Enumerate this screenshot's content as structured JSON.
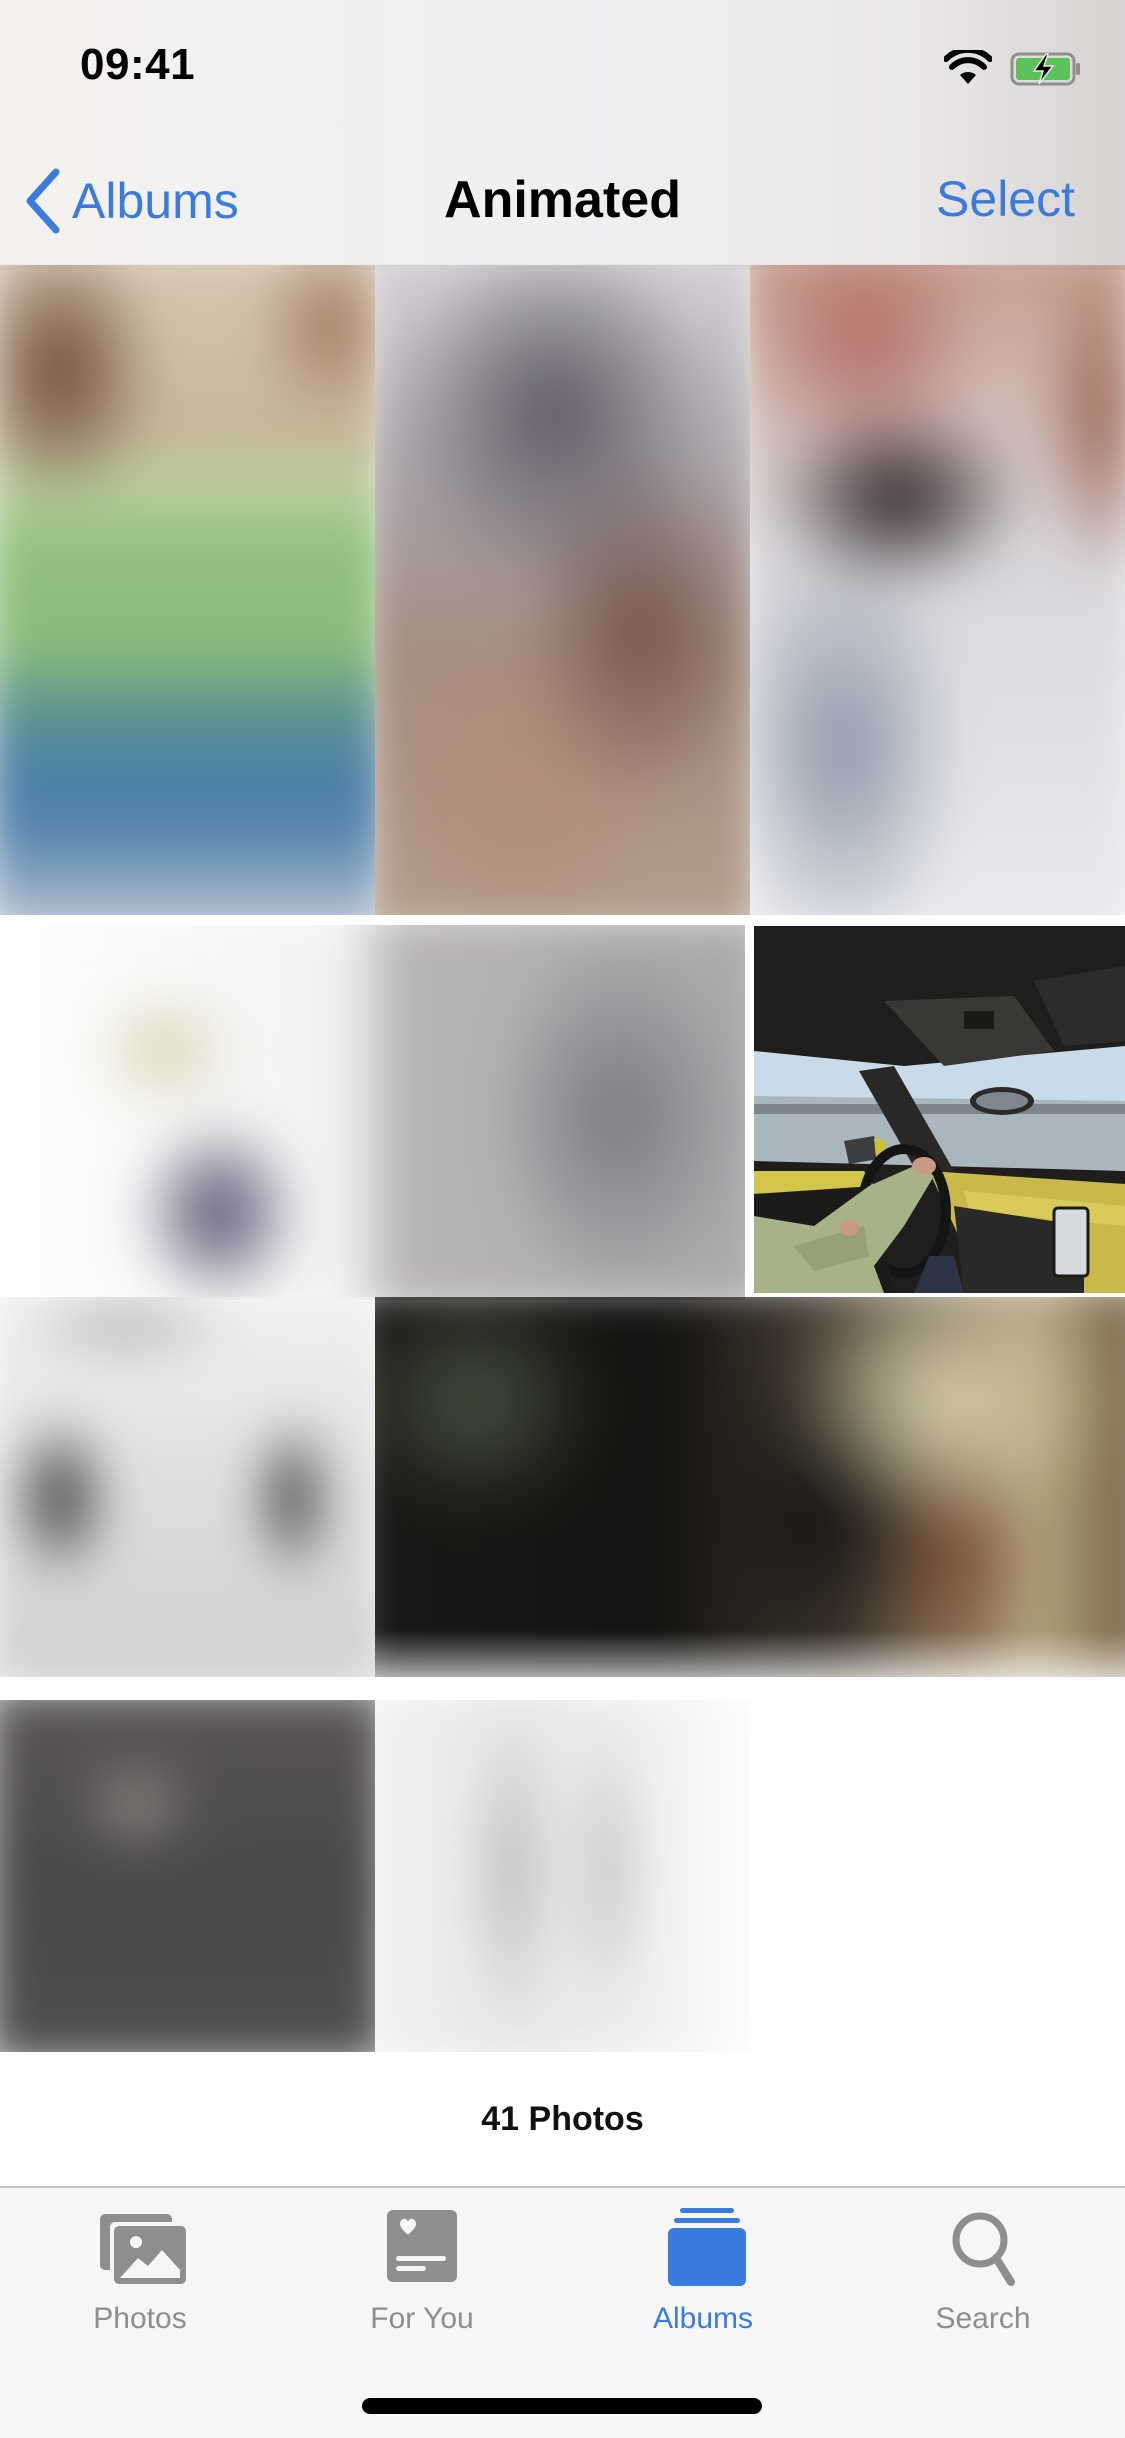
{
  "status_bar": {
    "time": "09:41",
    "icons": [
      "wifi-icon",
      "battery-charging-icon"
    ],
    "battery_color": "#5cc35a"
  },
  "nav": {
    "back_label": "Albums",
    "back_icon": "chevron-left-icon",
    "title": "Animated",
    "select_label": "Select",
    "accent": "#3a7be0"
  },
  "grid": {
    "items": [
      {
        "label": "Blurred photo 1"
      },
      {
        "label": "Blurred photo 2"
      },
      {
        "label": "Blurred photo 3"
      },
      {
        "label": "Blurred photo 4"
      },
      {
        "label": "Highlighted photo - driving car interior"
      },
      {
        "label": "Blurred photo 5"
      },
      {
        "label": "Blurred photo 6"
      },
      {
        "label": "Blurred photo 7"
      },
      {
        "label": "Blurred photo 8"
      }
    ]
  },
  "footer": {
    "count_label": "41 Photos"
  },
  "tabbar": {
    "active_color": "#3a7be0",
    "inactive_color": "#8e8e8e",
    "tabs": [
      {
        "label": "Photos",
        "icon": "photos-icon",
        "active": false
      },
      {
        "label": "For You",
        "icon": "for-you-icon",
        "active": false
      },
      {
        "label": "Albums",
        "icon": "albums-icon",
        "active": true
      },
      {
        "label": "Search",
        "icon": "search-icon",
        "active": false
      }
    ]
  }
}
